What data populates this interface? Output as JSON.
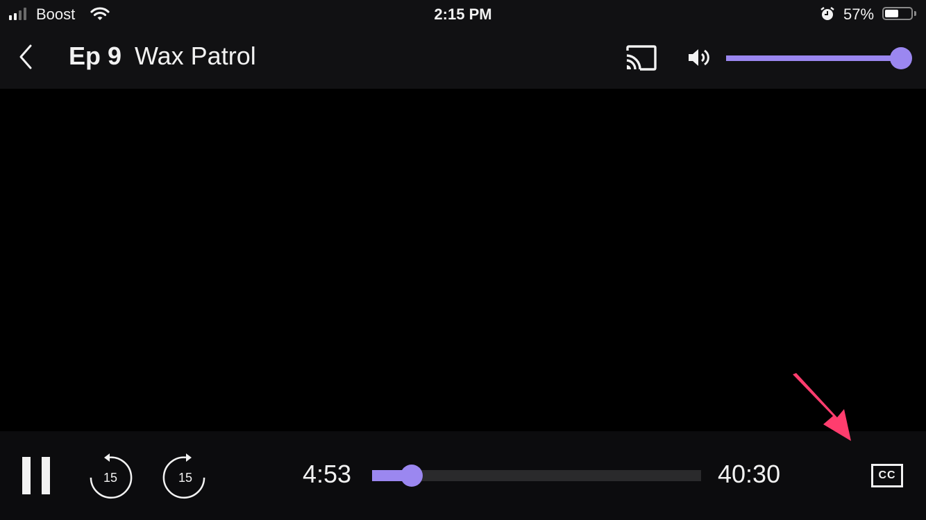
{
  "status_bar": {
    "carrier": "Boost",
    "signal_bars": 2,
    "signal_total": 4,
    "time": "2:15 PM",
    "battery_percent_label": "57%",
    "battery_level": 0.57,
    "icons": [
      "signal-icon",
      "wifi-icon",
      "alarm-icon",
      "battery-icon"
    ]
  },
  "header": {
    "back_icon": "chevron-left-icon",
    "episode": "Ep 9",
    "title": "Wax Patrol",
    "cast_icon": "cast-icon",
    "volume_icon": "speaker-icon",
    "volume_level": 1.0
  },
  "controls": {
    "pause_icon": "pause-icon",
    "rewind_seconds": "15",
    "forward_seconds": "15",
    "current_time": "4:53",
    "total_time": "40:30",
    "progress": 0.12,
    "cc_label": "CC"
  },
  "colors": {
    "accent": "#9b87f0",
    "annotation_arrow": "#ff3d6e",
    "bar_bg": "#111113"
  },
  "annotation": {
    "type": "arrow",
    "points_to": "cc-button"
  }
}
